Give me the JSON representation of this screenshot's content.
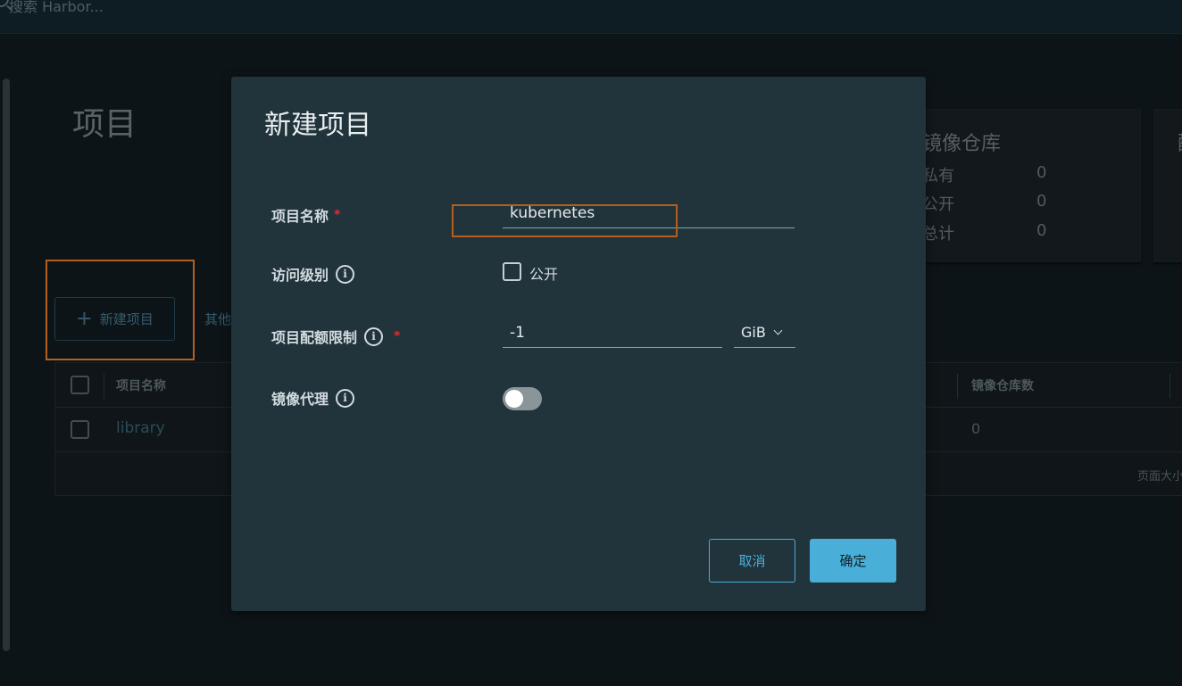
{
  "header": {
    "search_placeholder": "搜索 Harbor..."
  },
  "page": {
    "title": "项目",
    "new_project_label": "新建项目",
    "other_label": "其他"
  },
  "stats": {
    "card_title": "镜像仓库",
    "rows": [
      {
        "label": "私有",
        "value": "0"
      },
      {
        "label": "公开",
        "value": "0"
      },
      {
        "label": "总计",
        "value": "0"
      }
    ],
    "card2_text": "配"
  },
  "table": {
    "columns": {
      "name": "项目名称",
      "repos": "镜像仓库数"
    },
    "rows": [
      {
        "name": "library",
        "repos": "0"
      }
    ],
    "footer": "页面大小"
  },
  "modal": {
    "title": "新建项目",
    "fields": {
      "name_label": "项目名称",
      "name_value": "kubernetes",
      "access_label": "访问级别",
      "public_label": "公开",
      "quota_label": "项目配额限制",
      "quota_value": "-1",
      "quota_unit": "GiB",
      "proxy_label": "镜像代理"
    },
    "cancel": "取消",
    "ok": "确定"
  },
  "colors": {
    "accent": "#49afd9",
    "highlight": "#b45f1c",
    "modal_bg": "#21333b"
  }
}
